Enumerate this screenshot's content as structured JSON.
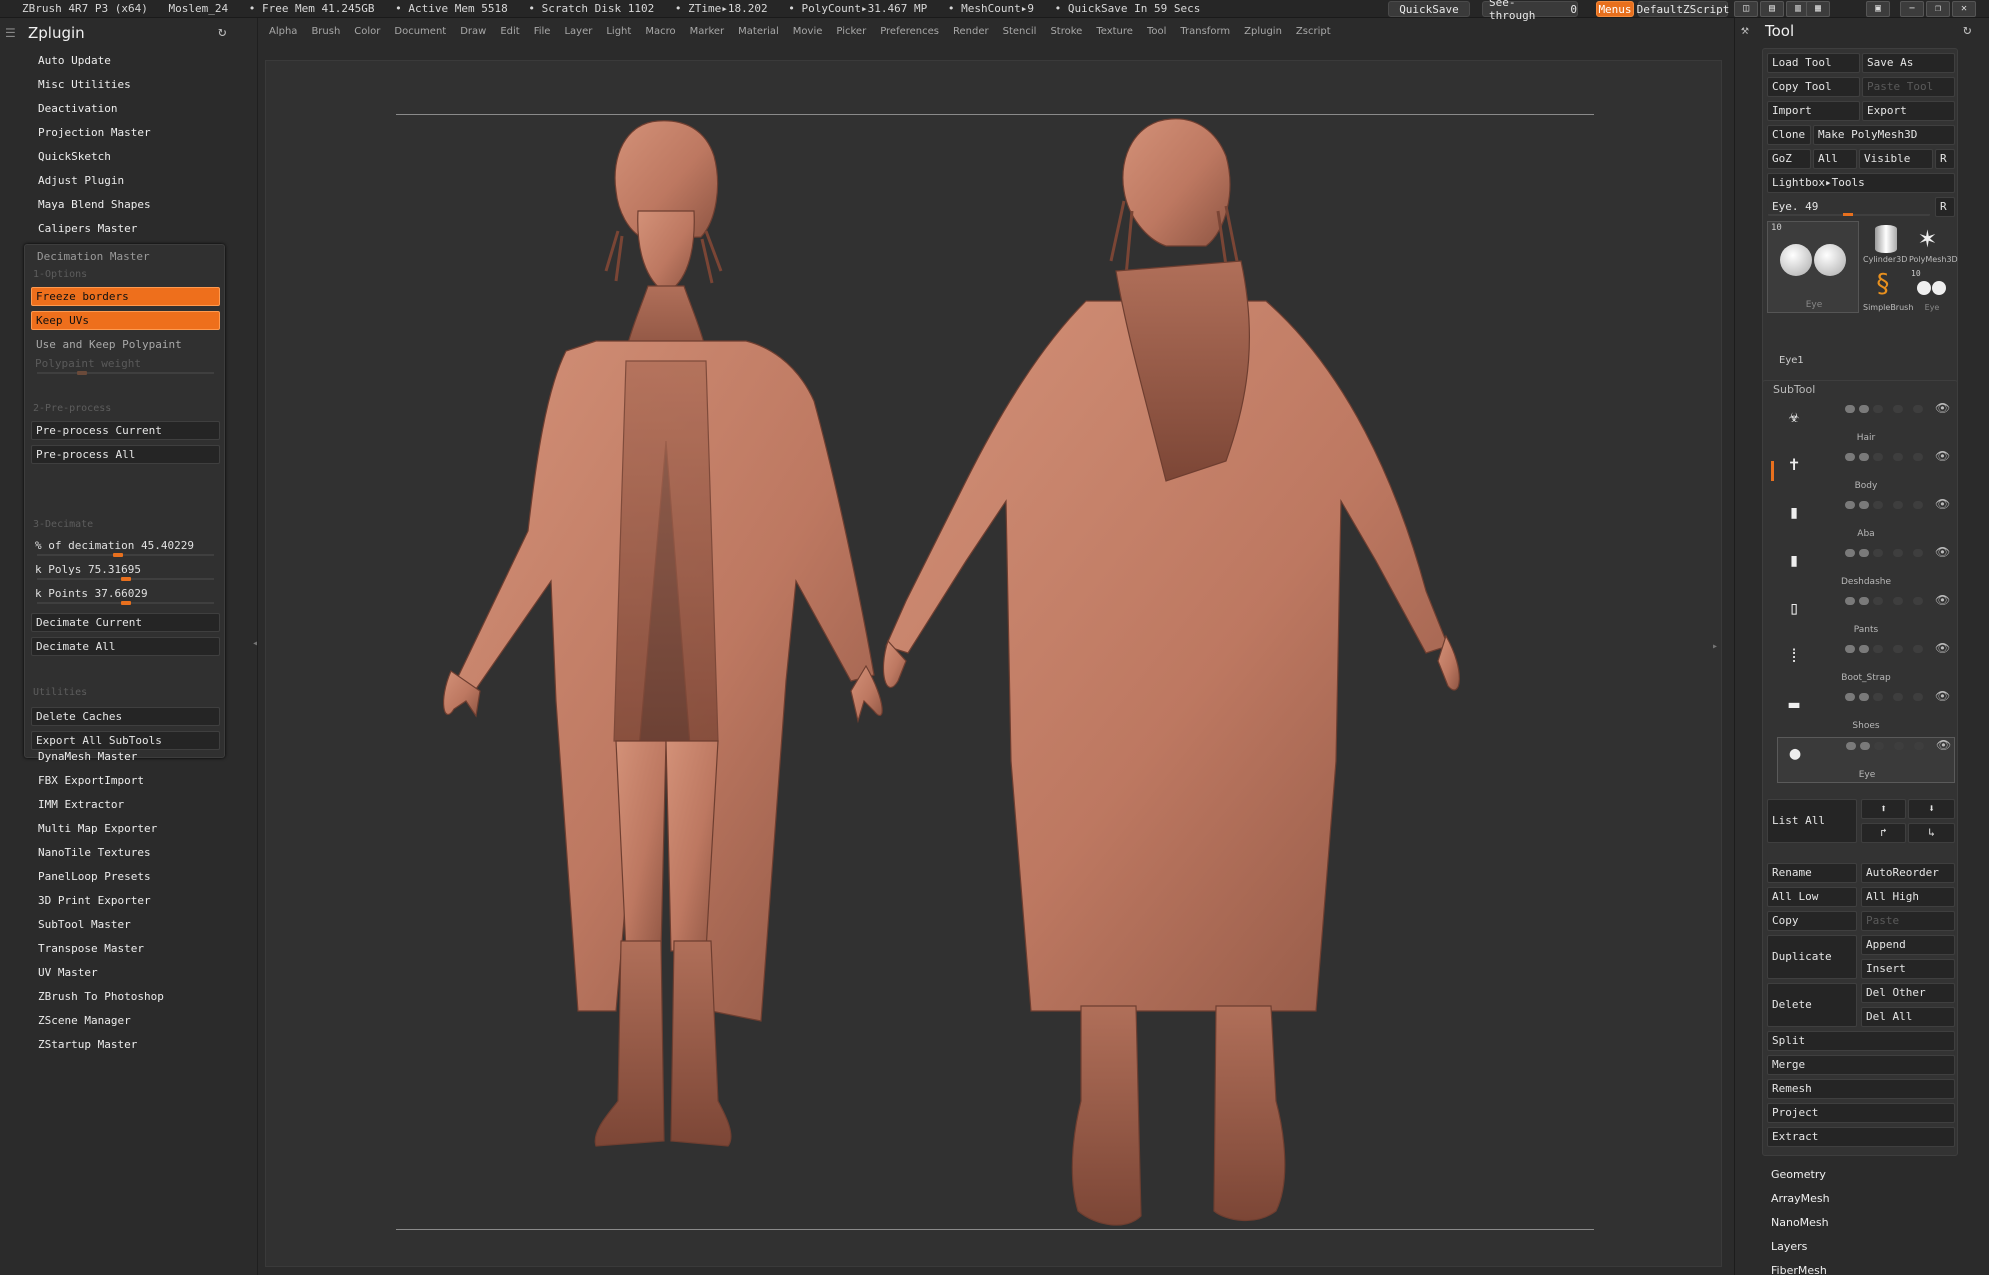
{
  "titlebar": {
    "app": "ZBrush 4R7 P3 (x64)",
    "document": "Moslem_24",
    "free_mem": "• Free Mem 41.245GB",
    "active_mem": "• Active Mem 5518",
    "scratch": "• Scratch Disk 1102",
    "ztime": "• ZTime▸18.202",
    "polycount": "• PolyCount▸31.467 MP",
    "meshcount": "• MeshCount▸9",
    "quicksave_status": "• QuickSave In 59 Secs",
    "quicksave_btn": "QuickSave",
    "see_through_label": "See-through",
    "see_through_value": "0",
    "menus_btn": "Menus",
    "script_btn": "DefaultZScript"
  },
  "menubar": [
    "Alpha",
    "Brush",
    "Color",
    "Document",
    "Draw",
    "Edit",
    "File",
    "Layer",
    "Light",
    "Macro",
    "Marker",
    "Material",
    "Movie",
    "Picker",
    "Preferences",
    "Render",
    "Stencil",
    "Stroke",
    "Texture",
    "Tool",
    "Transform",
    "Zplugin",
    "Zscript"
  ],
  "left": {
    "title": "Zplugin",
    "plugins_top": [
      "Auto Update",
      "Misc Utilities",
      "Deactivation",
      "Projection Master",
      "QuickSketch",
      "Adjust Plugin",
      "Maya Blend Shapes",
      "Calipers Master"
    ],
    "decimation": {
      "title": "Decimation Master",
      "sec1": "1-Options",
      "freeze": "Freeze borders",
      "keepuv": "Keep UVs",
      "usepoly": "Use and Keep Polypaint",
      "polyweight": "Polypaint weight",
      "sec2": "2-Pre-process",
      "precur": "Pre-process Current",
      "preall": "Pre-process All",
      "sec3": "3-Decimate",
      "pct": "% of decimation 45.40229",
      "pct_value": 0.454,
      "kpolys": "k Polys 75.31695",
      "kpolys_value": 0.5,
      "kpoints": "k Points 37.66029",
      "kpoints_value": 0.5,
      "deccur": "Decimate Current",
      "decall": "Decimate All",
      "sec4": "Utilities",
      "delcache": "Delete Caches",
      "export": "Export All SubTools"
    },
    "plugins_bottom": [
      "DynaMesh Master",
      "FBX ExportImport",
      "IMM Extractor",
      "Multi Map Exporter",
      "NanoTile Textures",
      "PanelLoop Presets",
      "3D Print Exporter",
      "SubTool Master",
      "Transpose Master",
      "UV Master",
      "ZBrush To Photoshop",
      "ZScene Manager",
      "ZStartup Master"
    ]
  },
  "right": {
    "title": "Tool",
    "load": "Load Tool",
    "saveas": "Save As",
    "copy": "Copy Tool",
    "paste": "Paste Tool",
    "import": "Import",
    "export": "Export",
    "clone": "Clone",
    "polymesh": "Make PolyMesh3D",
    "goz": "GoZ",
    "all": "All",
    "visible": "Visible",
    "r": "R",
    "lightbox": "Lightbox▸Tools",
    "eye_slider": "Eye. 49",
    "eye_value": 0.49,
    "thumbs": {
      "count1": "10",
      "count2": "10",
      "cyl": "Cylinder3D",
      "poly": "PolyMesh3D",
      "simple": "SimpleBrush",
      "eye": "Eye",
      "eyebig": "Eye"
    },
    "current": "Eye1",
    "subtool_title": "SubTool",
    "subtools": [
      "Hair",
      "Body",
      "Aba",
      "Deshdashe",
      "Pants",
      "Boot_Strap",
      "Shoes",
      "Eye"
    ],
    "listall": "List All",
    "rename": "Rename",
    "autoreorder": "AutoReorder",
    "alllow": "All Low",
    "allhigh": "All High",
    "copy2": "Copy",
    "paste2": "Paste",
    "duplicate": "Duplicate",
    "append": "Append",
    "insert": "Insert",
    "delete": "Delete",
    "delother": "Del Other",
    "delall": "Del All",
    "split": "Split",
    "merge": "Merge",
    "remesh": "Remesh",
    "project": "Project",
    "extract": "Extract",
    "sections": [
      "Geometry",
      "ArrayMesh",
      "NanoMesh",
      "Layers",
      "FiberMesh"
    ]
  },
  "colors": {
    "accent": "#e8701e",
    "clay": "#c07a62",
    "bg": "#2b2b2b"
  }
}
